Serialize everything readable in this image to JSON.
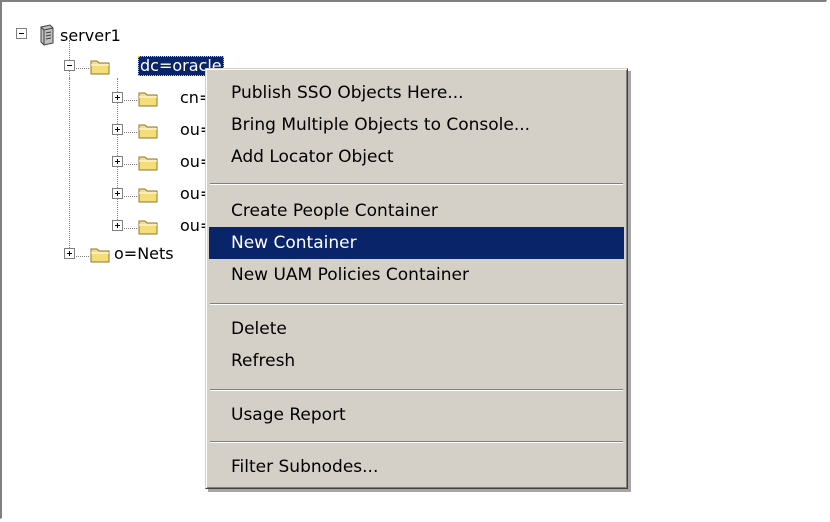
{
  "tree": {
    "root": {
      "label": "server1",
      "icon": "server-icon"
    },
    "nodes": [
      {
        "label": "dc=oracle",
        "selected": true,
        "expanded": true
      },
      {
        "label": "cn="
      },
      {
        "label": "ou="
      },
      {
        "label": "ou="
      },
      {
        "label": "ou="
      },
      {
        "label": "ou="
      },
      {
        "label": "o=Nets"
      }
    ]
  },
  "context_menu": {
    "items": [
      {
        "label": "Publish SSO Objects Here..."
      },
      {
        "label": "Bring Multiple Objects to Console..."
      },
      {
        "label": "Add Locator Object"
      },
      {
        "label": "Create People Container"
      },
      {
        "label": "New Container",
        "highlighted": true
      },
      {
        "label": "New UAM Policies Container"
      },
      {
        "label": "Delete"
      },
      {
        "label": "Refresh"
      },
      {
        "label": "Usage Report"
      },
      {
        "label": "Filter Subnodes..."
      }
    ]
  },
  "colors": {
    "selection": "#0a246a",
    "menu_background": "#d4d0c8",
    "folder_fill": "#f5dd7a"
  }
}
